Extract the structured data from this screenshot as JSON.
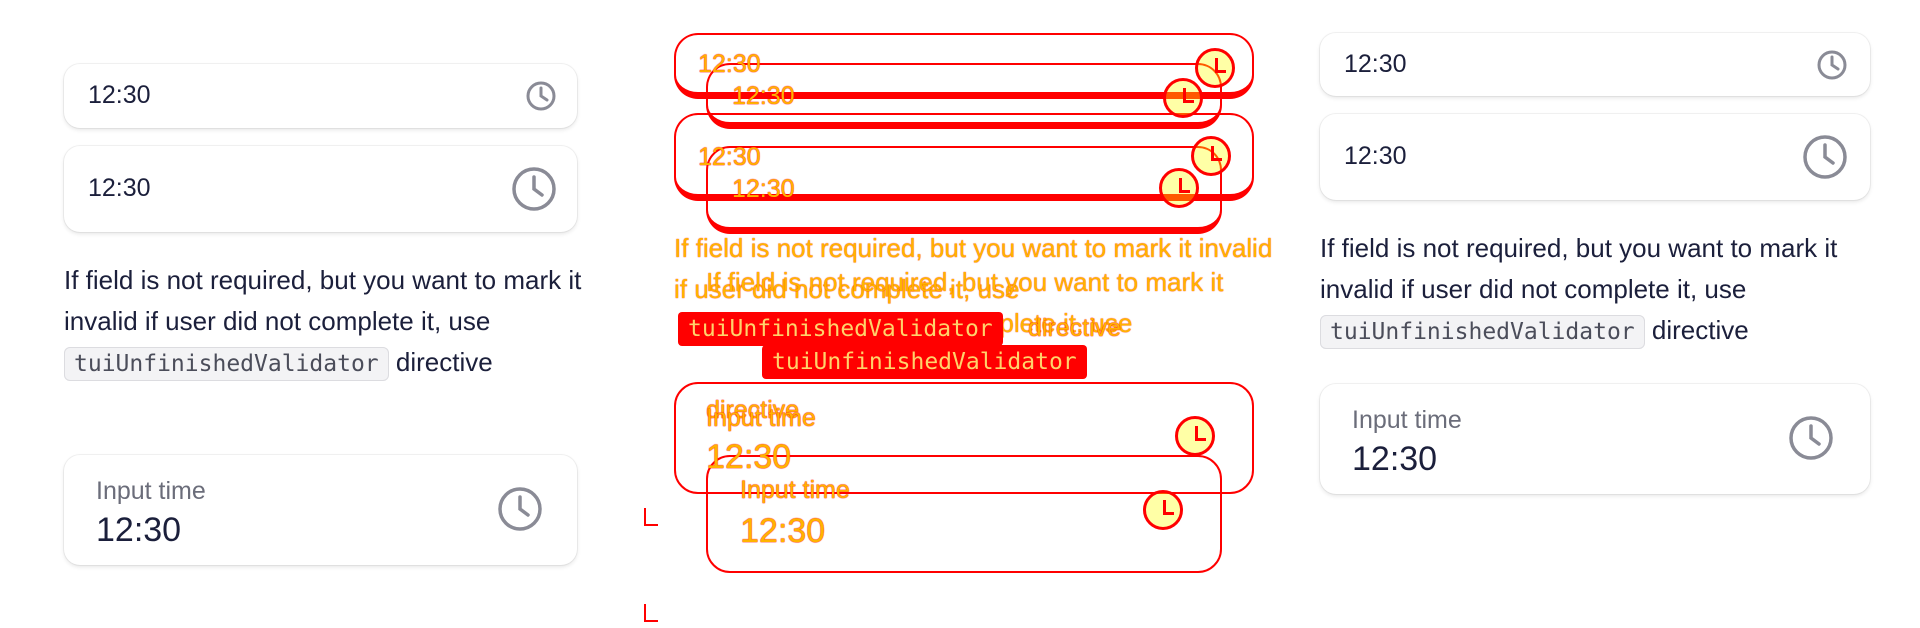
{
  "time_value": "12:30",
  "hint": {
    "before": "If field is not required, but you want to mark it invalid if user did not complete it, use",
    "code": "tuiUnfinishedValidator",
    "after": "directive"
  },
  "labeled_input": {
    "label": "Input time",
    "value": "12:30"
  },
  "icons": {
    "time": "clock-icon"
  },
  "colors": {
    "text": "#1b1f3b",
    "label": "#6b6d7a",
    "icon": "#8a8b96",
    "overlay_stroke": "#ff0000",
    "overlay_text": "#ffb400"
  }
}
